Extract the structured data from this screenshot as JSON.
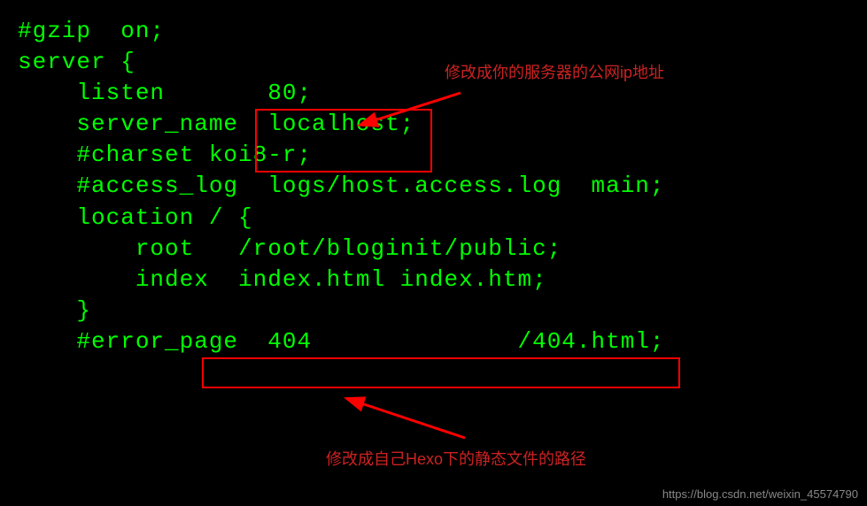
{
  "code": {
    "l1": "#gzip  on;",
    "l2": "",
    "l3": "server {",
    "l4": "    listen       80;",
    "l5": "    server_name  localhost;",
    "l6": "",
    "l7": "    #charset koi8-r;",
    "l8": "",
    "l9": "    #access_log  logs/host.access.log  main;",
    "l10": "",
    "l11": "    location / {",
    "l12": "        root   /root/bloginit/public;",
    "l13": "        index  index.html index.htm;",
    "l14": "    }",
    "l15": "",
    "l16": "    #error_page  404              /404.html;"
  },
  "annotations": {
    "top": "修改成你的服务器的公网ip地址",
    "bottom": "修改成自己Hexo下的静态文件的路径"
  },
  "watermark": "https://blog.csdn.net/weixin_45574790"
}
